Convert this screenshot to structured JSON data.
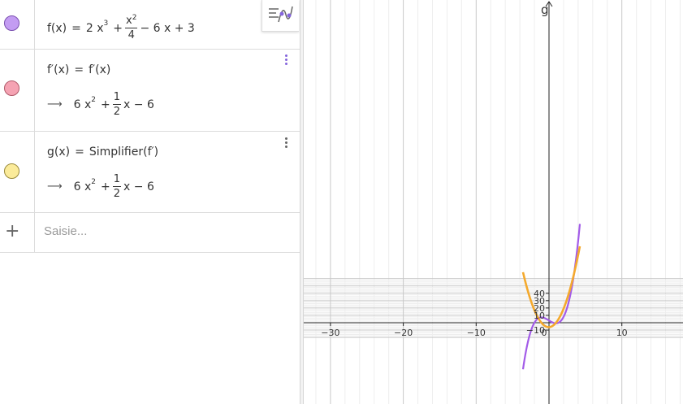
{
  "colors": {
    "f": "#a35ce8",
    "f_prime": "#f08ca0",
    "g": "#f7e08a",
    "g_curve": "#f4a92d",
    "accent": "#8465dc"
  },
  "algebra": {
    "rows": [
      {
        "name": "f",
        "lhs": "f(x)",
        "eq": "=",
        "t1": "2 x",
        "t1_exp": "3",
        "plus1": "+",
        "frac_num": "x",
        "frac_num_exp": "2",
        "frac_den": "4",
        "rest": "− 6 x + 3"
      },
      {
        "name": "f_prime",
        "lhs": "f′(x)",
        "eq": "=",
        "rhs": "f′(x)",
        "arrow": "⟶",
        "r1": "6 x",
        "r1_exp": "2",
        "plus": "+",
        "frac_num": "1",
        "frac_den": "2",
        "rest": "x − 6"
      },
      {
        "name": "g",
        "lhs": "g(x)",
        "eq": "=",
        "rhs": "Simplifier(f′)",
        "arrow": "⟶",
        "r1": "6 x",
        "r1_exp": "2",
        "plus": "+",
        "frac_num": "1",
        "frac_den": "2",
        "rest": "x − 6"
      }
    ],
    "input_placeholder": "Saisie..."
  },
  "graph": {
    "curve_label": "g",
    "x_ticks": [
      "−30",
      "−20",
      "−10",
      "0",
      "10"
    ],
    "y_ticks": [
      "40",
      "30",
      "20",
      "10",
      "−10"
    ],
    "functions": {
      "f": "2x^3 + x^2/4 - 6x + 3",
      "g": "6x^2 + x/2 - 6"
    }
  }
}
